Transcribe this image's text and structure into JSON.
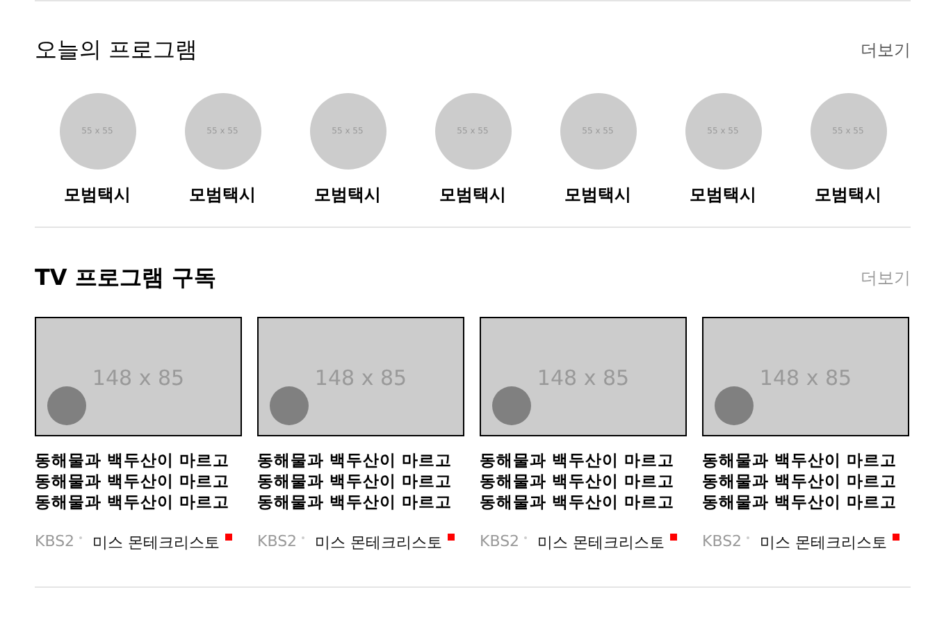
{
  "today": {
    "title": "오늘의 프로그램",
    "more": "더보기",
    "programs": [
      {
        "image_label": "55 x 55",
        "name": "모범택시"
      },
      {
        "image_label": "55 x 55",
        "name": "모범택시"
      },
      {
        "image_label": "55 x 55",
        "name": "모범택시"
      },
      {
        "image_label": "55 x 55",
        "name": "모범택시"
      },
      {
        "image_label": "55 x 55",
        "name": "모범택시"
      },
      {
        "image_label": "55 x 55",
        "name": "모범택시"
      },
      {
        "image_label": "55 x 55",
        "name": "모범택시"
      }
    ]
  },
  "subscriptions": {
    "title": "TV 프로그램 구독",
    "more": "더보기",
    "cards": [
      {
        "image_label": "148 x 85",
        "lines": [
          "동해물과 백두산이 마르고",
          "동해물과 백두산이 마르고",
          "동해물과 백두산이 마르고"
        ],
        "channel": "KBS2",
        "program": "미스 몬테크리스토"
      },
      {
        "image_label": "148 x 85",
        "lines": [
          "동해물과 백두산이 마르고",
          "동해물과 백두산이 마르고",
          "동해물과 백두산이 마르고"
        ],
        "channel": "KBS2",
        "program": "미스 몬테크리스토"
      },
      {
        "image_label": "148 x 85",
        "lines": [
          "동해물과 백두산이 마르고",
          "동해물과 백두산이 마르고",
          "동해물과 백두산이 마르고"
        ],
        "channel": "KBS2",
        "program": "미스 몬테크리스토"
      },
      {
        "image_label": "148 x 85",
        "lines": [
          "동해물과 백두산이 마르고",
          "동해물과 백두산이 마르고",
          "동해물과 백두산이 마르고"
        ],
        "channel": "KBS2",
        "program": "미스 몬테크리스토"
      }
    ]
  }
}
